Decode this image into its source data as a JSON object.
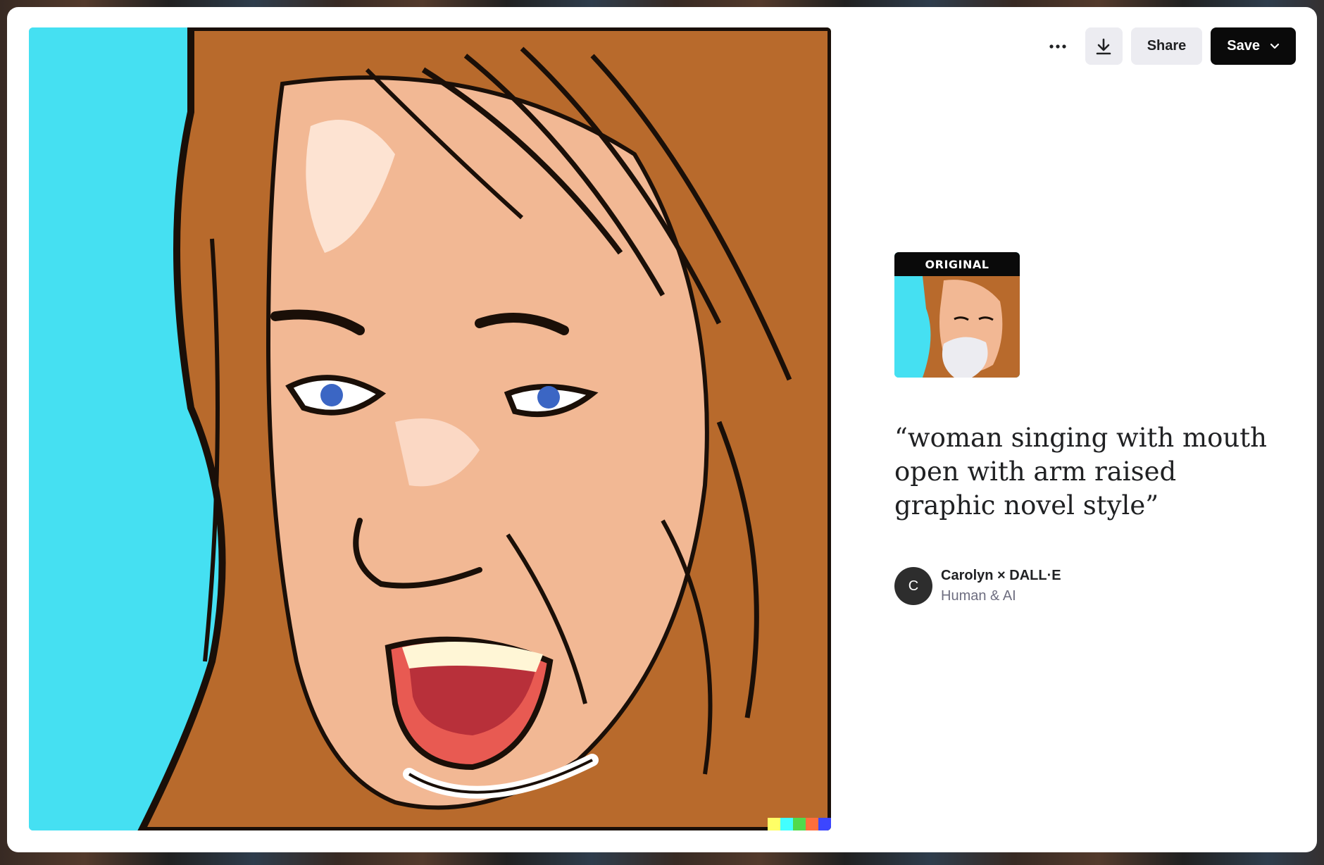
{
  "toolbar": {
    "more_icon": "more-horizontal-icon",
    "download_icon": "download-icon",
    "share_label": "Share",
    "save_label": "Save",
    "save_icon": "chevron-down-icon"
  },
  "image": {
    "signature_colors": [
      "#ffff66",
      "#42ffff",
      "#51da4c",
      "#ff6e3c",
      "#3c46ff"
    ]
  },
  "original": {
    "label": "ORIGINAL"
  },
  "prompt": {
    "text": "“woman singing with mouth open with arm raised graphic novel style”"
  },
  "author": {
    "initial": "C",
    "name": "Carolyn × DALL·E",
    "subtitle": "Human & AI"
  },
  "colors": {
    "background_cyan": "#45e0f2",
    "hair": "#b86a2c",
    "skin": "#f2b894",
    "save_button_bg": "#0a0a0a",
    "secondary_button_bg": "#ececf1"
  }
}
